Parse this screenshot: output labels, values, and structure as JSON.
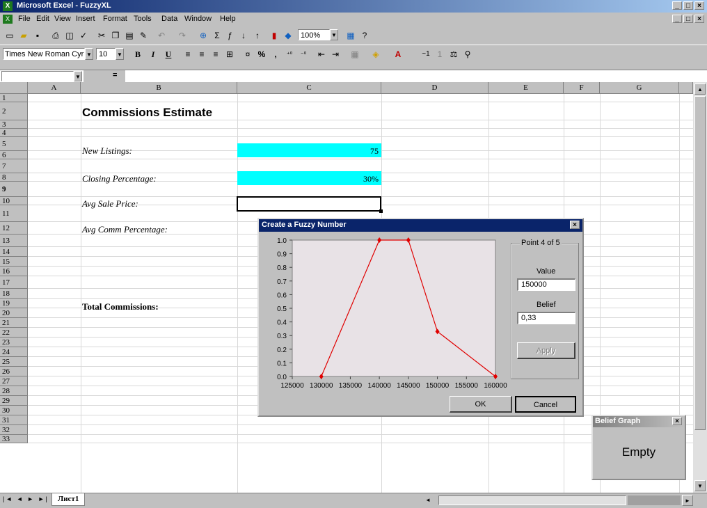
{
  "window": {
    "title": "Microsoft Excel - FuzzyXL",
    "minimize": "_",
    "maximize": "□",
    "close": "×"
  },
  "menu": {
    "items": [
      "File",
      "Edit",
      "View",
      "Insert",
      "Format",
      "Tools",
      "Data",
      "Window",
      "Help"
    ]
  },
  "toolbar": {
    "zoom": "100%",
    "font_name": "Times New Roman Cyr",
    "font_size": "10",
    "bold": "B",
    "italic": "I",
    "underline": "U",
    "percent": "%",
    "comma": ","
  },
  "formula_bar": {
    "name_box": "",
    "equals": "="
  },
  "grid": {
    "columns": [
      "A",
      "B",
      "C",
      "D",
      "E",
      "F",
      "G"
    ],
    "rows": [
      "1",
      "2",
      "3",
      "4",
      "5",
      "6",
      "7",
      "8",
      "9",
      "10",
      "11",
      "12",
      "13",
      "14",
      "15",
      "16",
      "17",
      "18",
      "19",
      "20",
      "21",
      "22",
      "23",
      "24",
      "25",
      "26",
      "27",
      "28",
      "29",
      "30",
      "31",
      "32",
      "33"
    ],
    "cells": {
      "title": "Commissions Estimate",
      "new_listings_label": "New Listings:",
      "new_listings_value": "75",
      "closing_pct_label": "Closing Percentage:",
      "closing_pct_value": "30%",
      "avg_sale_label": "Avg Sale Price:",
      "avg_comm_label": "Avg Comm Percentage:",
      "total_label": "Total Commissions:"
    },
    "input_cell_color": "#00ffff"
  },
  "sheet_tabs": {
    "active": "Лист1"
  },
  "dialog": {
    "title": "Create a Fuzzy Number",
    "group_label": "Point 4 of 5",
    "value_label": "Value",
    "value": "150000",
    "belief_label": "Belief",
    "belief": "0,33",
    "apply": "Apply",
    "ok": "OK",
    "cancel": "Cancel"
  },
  "chart_data": {
    "type": "line",
    "x": [
      130000,
      140000,
      145000,
      150000,
      160000
    ],
    "y": [
      0.0,
      1.0,
      1.0,
      0.33,
      0.0
    ],
    "x_ticks": [
      "125000",
      "130000",
      "135000",
      "140000",
      "145000",
      "150000",
      "155000",
      "160000"
    ],
    "y_ticks": [
      "1.0",
      "0.9",
      "0.8",
      "0.7",
      "0.6",
      "0.5",
      "0.4",
      "0.3",
      "0.2",
      "0.1",
      "0.0"
    ],
    "xlim": [
      125000,
      160000
    ],
    "ylim": [
      0,
      1
    ],
    "line_color": "#e00000",
    "plot_bg": "#e8e2e6",
    "grid": false
  },
  "belief_graph": {
    "title": "Belief Graph",
    "close": "×",
    "content": "Empty"
  }
}
